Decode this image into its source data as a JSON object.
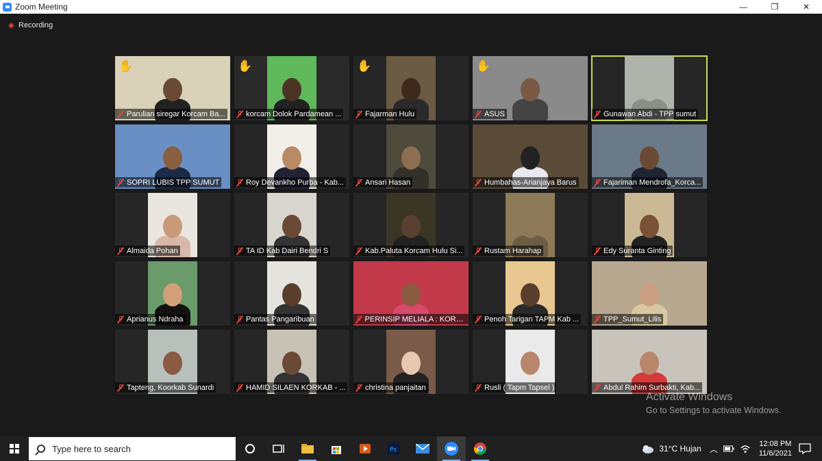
{
  "window": {
    "title": "Zoom Meeting",
    "minimize": "—",
    "maximize": "❐",
    "close": "✕"
  },
  "recording": {
    "label": "Recording"
  },
  "participants": [
    {
      "name": "Parulian siregar Korcam Ba...",
      "hand": true,
      "bg": "#3c3c3a",
      "video_bg": "#d9d2b8",
      "skin": "#6b4a35",
      "shirt": "#222"
    },
    {
      "name": "korcam Dolok Pardamean ...",
      "hand": true,
      "bg": "#2a2a2a",
      "video_bg": "#5fb85a",
      "skin": "#4a3424",
      "shirt": "#222"
    },
    {
      "name": "Fajarman Hulu",
      "hand": true,
      "bg": "#262626",
      "video_bg": "#6b5a44",
      "skin": "#3d2a1d",
      "shirt": "#2a2a2a"
    },
    {
      "name": "ASUS",
      "hand": true,
      "bg": "#6d6d6d",
      "video_bg": "#8a8a8a",
      "skin": "#7a5a45",
      "shirt": "#444"
    },
    {
      "name": "Gunawan Abdi - TPP sumut",
      "hand": false,
      "bg": "#262626",
      "video_bg": "#b0b3ac",
      "skin": "#b0b3ac",
      "shirt": "#8c8f88",
      "active": true
    },
    {
      "name": "SOPRI LUBIS TPP SUMUT",
      "hand": false,
      "bg": "#6a8fc4",
      "video_bg": "#6a8fc4",
      "skin": "#8a5e40",
      "shirt": "#1c2b45"
    },
    {
      "name": "Roy Devankho Purba - Kab...",
      "hand": false,
      "bg": "#262626",
      "video_bg": "#f2eee8",
      "skin": "#b88a66",
      "shirt": "#223"
    },
    {
      "name": "Ansari Hasan",
      "hand": false,
      "bg": "#262626",
      "video_bg": "#4e4a3c",
      "skin": "#8c6e50",
      "shirt": "#33302a"
    },
    {
      "name": "Humbahas-Arianjaya Barus",
      "hand": false,
      "bg": "#4a3a2a",
      "video_bg": "#5a4a38",
      "skin": "#222",
      "shirt": "#e8e8ee"
    },
    {
      "name": "Fajariman Mendrofa_Korca...",
      "hand": false,
      "bg": "#6a7a88",
      "video_bg": "#6a7a88",
      "skin": "#6b4a35",
      "shirt": "#1e2430"
    },
    {
      "name": "Almaida Pohan",
      "hand": false,
      "bg": "#262626",
      "video_bg": "#e9e6df",
      "skin": "#c99a7a",
      "shirt": "#d8b8a8"
    },
    {
      "name": "TA ID Kab Dairi Bendri S",
      "hand": false,
      "bg": "#262626",
      "video_bg": "#d9d6cf",
      "skin": "#6b4a35",
      "shirt": "#333"
    },
    {
      "name": "Kab.Paluta Korcam Hulu Si...",
      "hand": false,
      "bg": "#262626",
      "video_bg": "#3a3626",
      "skin": "#5a4030",
      "shirt": "#222"
    },
    {
      "name": "Rustam Harahap",
      "hand": false,
      "bg": "#262626",
      "video_bg": "#8d7a58",
      "skin": "#8d7a58",
      "shirt": "#6b5e44"
    },
    {
      "name": "Edy Suranta Ginting",
      "hand": false,
      "bg": "#262626",
      "video_bg": "#cbb894",
      "skin": "#7a5238",
      "shirt": "#222"
    },
    {
      "name": "Aprianus Ndraha",
      "hand": false,
      "bg": "#262626",
      "video_bg": "#6b9a6b",
      "skin": "#d3a07a",
      "shirt": "#111"
    },
    {
      "name": "Pantas Pangaribuan",
      "hand": false,
      "bg": "#262626",
      "video_bg": "#e6e4de",
      "skin": "#5a3e2c",
      "shirt": "#333"
    },
    {
      "name": "PERINSIP MELIALA : KORCA...",
      "hand": false,
      "bg": "#7a3a3a",
      "video_bg": "#c23a4a",
      "skin": "#8a5a40",
      "shirt": "#d64a6a"
    },
    {
      "name": "Penoh Tarigan TAPM Kab ...",
      "hand": false,
      "bg": "#262626",
      "video_bg": "#e8c890",
      "skin": "#5a3e2c",
      "shirt": "#2a2a2a"
    },
    {
      "name": "TPP_Sumut_Lilis",
      "hand": false,
      "bg": "#b8a890",
      "video_bg": "#b8a890",
      "skin": "#caa080",
      "shirt": "#d8c8a0"
    },
    {
      "name": "Tapteng, Koorkab Sunardi",
      "hand": false,
      "bg": "#262626",
      "video_bg": "#b8c0bc",
      "skin": "#8a5a40",
      "shirt": "#b8c0bc"
    },
    {
      "name": "HAMID SILAEN  KORKAB - ...",
      "hand": false,
      "bg": "#262626",
      "video_bg": "#c8c2b6",
      "skin": "#6b4a35",
      "shirt": "#333"
    },
    {
      "name": "christina panjaitan",
      "hand": false,
      "bg": "#262626",
      "video_bg": "#7a5a48",
      "skin": "#e8c8b0",
      "shirt": "#222"
    },
    {
      "name": "Rusli ( Tapm Tapsel )",
      "hand": false,
      "bg": "#262626",
      "video_bg": "#eaeaea",
      "skin": "#b8866a",
      "shirt": "#e8e8e8"
    },
    {
      "name": "Abdul Rahim Surbakti, Kab...",
      "hand": false,
      "bg": "#c8c4bc",
      "video_bg": "#c8c4bc",
      "skin": "#b8866a",
      "shirt": "#d43a3a"
    }
  ],
  "watermark": {
    "line1": "Activate Windows",
    "line2": "Go to Settings to activate Windows."
  },
  "taskbar": {
    "search_placeholder": "Type here to search",
    "weather": "31°C  Hujan",
    "time": "12:08 PM",
    "date": "11/6/2021"
  }
}
